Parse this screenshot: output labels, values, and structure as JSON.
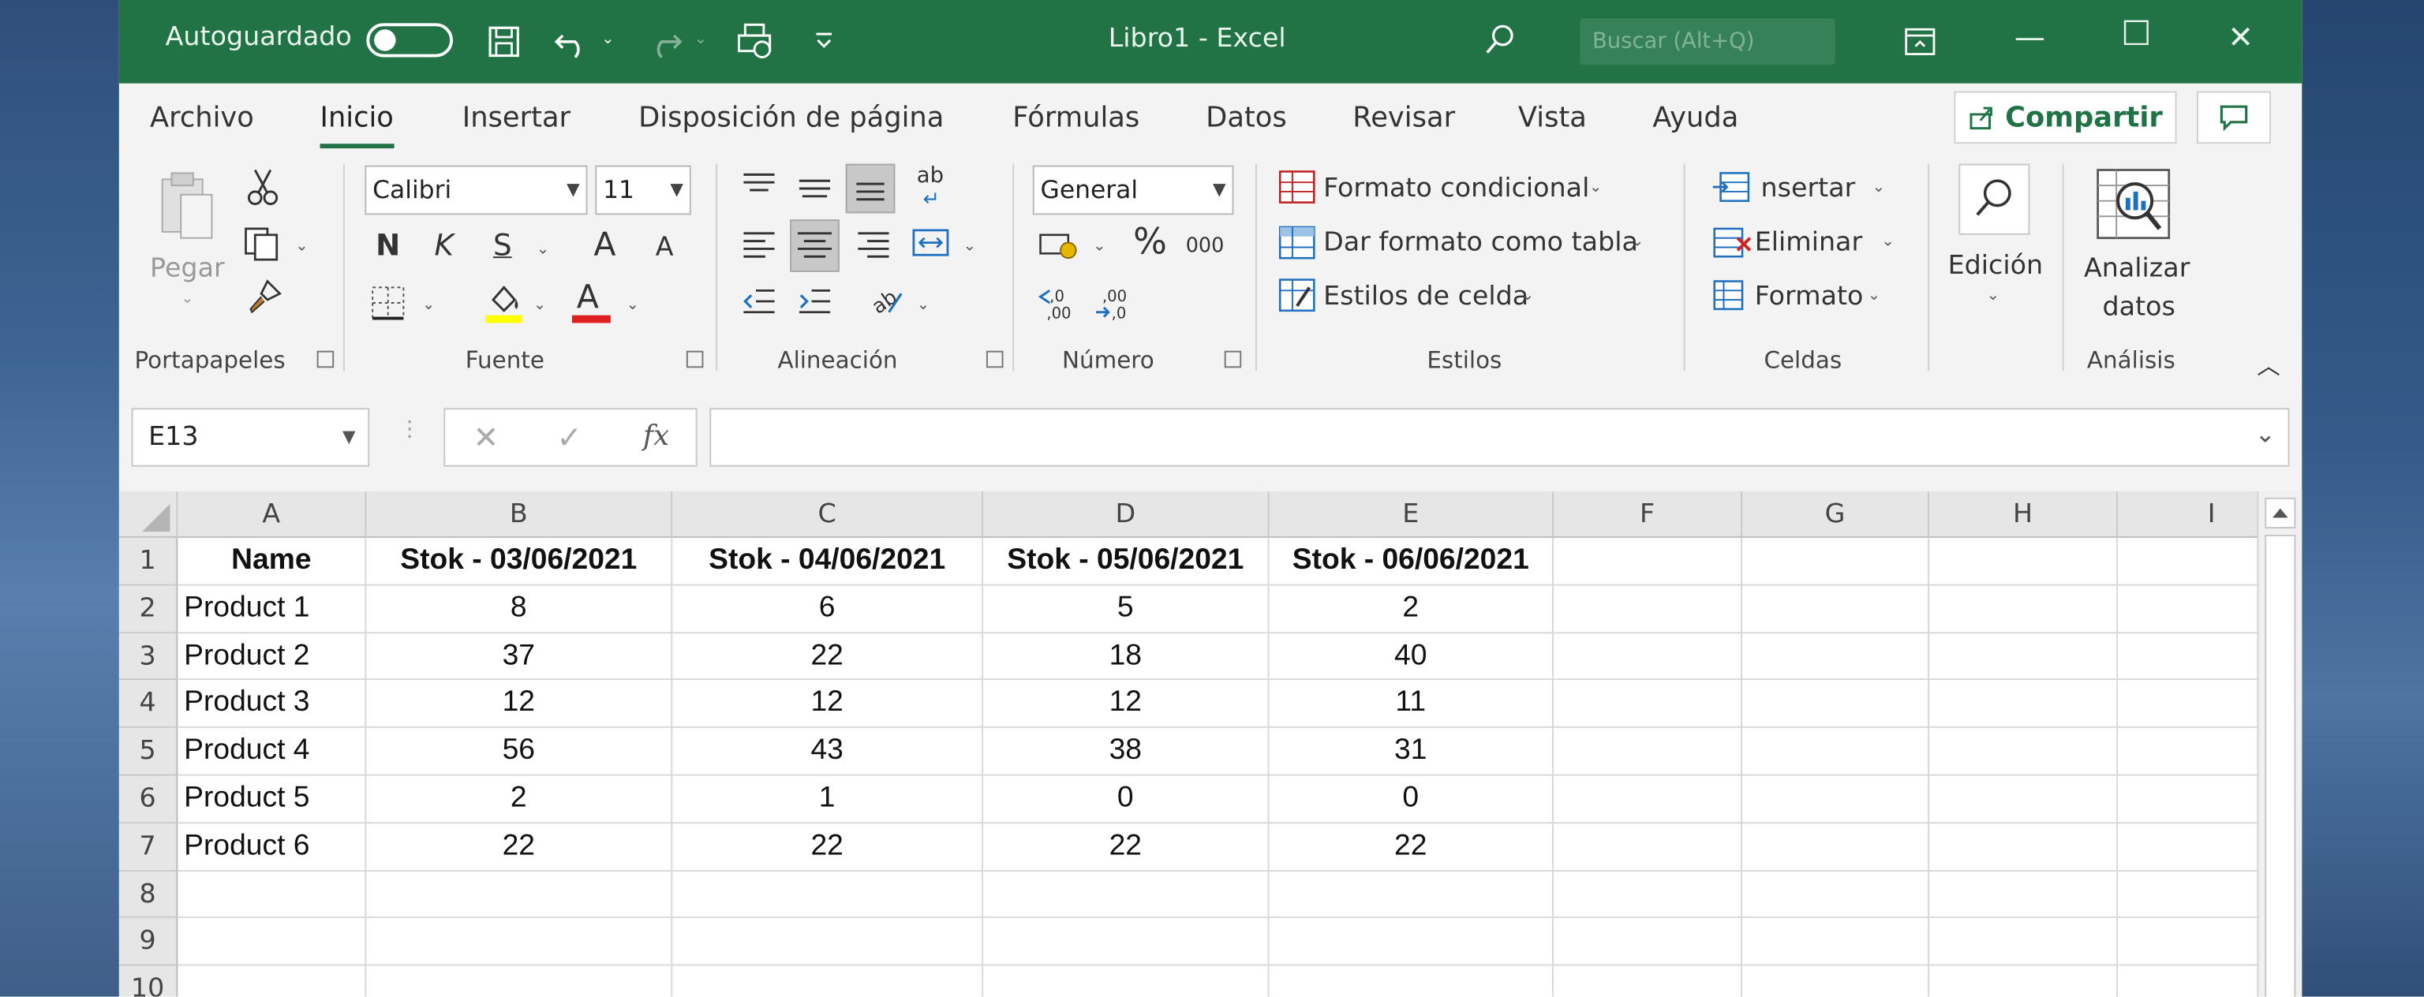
{
  "window": {
    "autosave_label": "Autoguardado",
    "title": "Libro1  -  Excel",
    "search_placeholder": "Buscar (Alt+Q)",
    "minimize_glyph": "—",
    "maximize_glyph": "☐",
    "close_glyph": "✕"
  },
  "menu_tabs": [
    "Archivo",
    "Inicio",
    "Insertar",
    "Disposición de página",
    "Fórmulas",
    "Datos",
    "Revisar",
    "Vista",
    "Ayuda"
  ],
  "share_label": "Compartir",
  "ribbon": {
    "clipboard": {
      "paste_label": "Pegar",
      "group_label": "Portapapeles"
    },
    "font": {
      "font_name": "Calibri",
      "font_size": "11",
      "bold_glyph": "N",
      "italic_glyph": "K",
      "underline_glyph": "S",
      "grow_glyph": "A",
      "shrink_glyph": "A",
      "font_color_glyph": "A",
      "group_label": "Fuente"
    },
    "alignment": {
      "group_label": "Alineación",
      "wrap_glyph": "ab"
    },
    "number": {
      "format": "General",
      "percent_glyph": "%",
      "thousands_glyph": "000",
      "group_label": "Número"
    },
    "styles": {
      "conditional_format": "Formato condicional",
      "format_as_table": "Dar formato como tabla",
      "cell_styles": "Estilos de celda",
      "group_label": "Estilos"
    },
    "cells": {
      "insert": "nsertar",
      "delete": "Eliminar",
      "format": "Formato",
      "group_label": "Celdas"
    },
    "editing": {
      "label": "Edición"
    },
    "analysis": {
      "line1": "Analizar",
      "line2": "datos",
      "group_label": "Análisis"
    }
  },
  "formula_bar": {
    "name_box": "E13",
    "fx_glyph": "fx",
    "cancel_glyph": "✕",
    "enter_glyph": "✓",
    "content": ""
  },
  "sheet": {
    "columns": [
      "A",
      "B",
      "C",
      "D",
      "E",
      "F",
      "G",
      "H",
      "I"
    ],
    "row_numbers": [
      "1",
      "2",
      "3",
      "4",
      "5",
      "6",
      "7",
      "8",
      "9",
      "10"
    ],
    "rows": [
      [
        "Name",
        "Stok - 03/06/2021",
        "Stok - 04/06/2021",
        "Stok - 05/06/2021",
        "Stok - 06/06/2021"
      ],
      [
        "Product 1",
        "8",
        "6",
        "5",
        "2"
      ],
      [
        "Product 2",
        "37",
        "22",
        "18",
        "40"
      ],
      [
        "Product 3",
        "12",
        "12",
        "12",
        "11"
      ],
      [
        "Product 4",
        "56",
        "43",
        "38",
        "31"
      ],
      [
        "Product 5",
        "2",
        "1",
        "0",
        "0"
      ],
      [
        "Product 6",
        "22",
        "22",
        "22",
        "22"
      ]
    ]
  },
  "colors": {
    "accent": "#217346",
    "header_bg": "#e6e6e6",
    "ribbon_bg": "#f3f3f3"
  }
}
